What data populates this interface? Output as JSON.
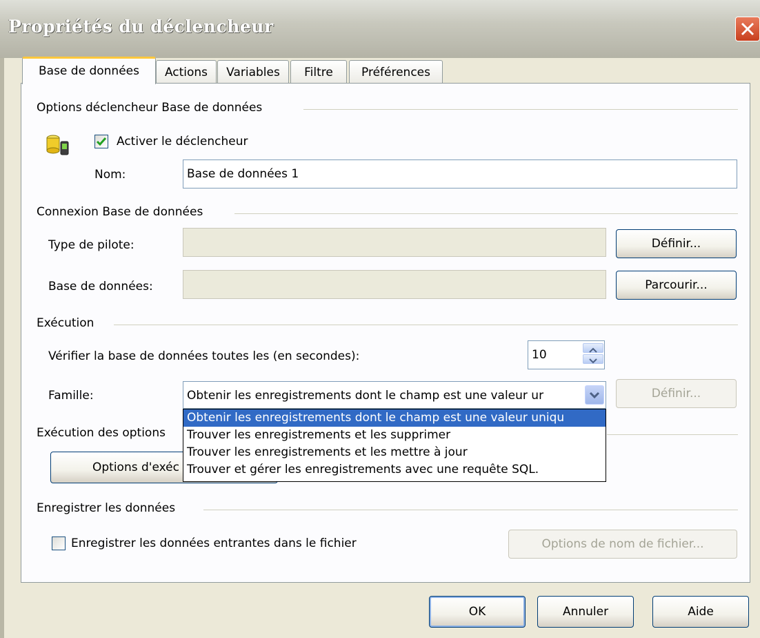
{
  "window": {
    "title": "Propriétés du déclencheur"
  },
  "tabs": [
    {
      "label": "Base de données",
      "active": true
    },
    {
      "label": "Actions",
      "active": false
    },
    {
      "label": "Variables",
      "active": false
    },
    {
      "label": "Filtre",
      "active": false
    },
    {
      "label": "Préférences",
      "active": false
    }
  ],
  "options_group": {
    "title": "Options déclencheur Base de données",
    "enable_checkbox": {
      "label": "Activer le déclencheur",
      "checked": true
    },
    "name_label": "Nom:",
    "name_value": "Base de données 1"
  },
  "connection_group": {
    "title": "Connexion Base de données",
    "driver_label": "Type de pilote:",
    "driver_value": "",
    "define_button": "Définir...",
    "database_label": "Base de données:",
    "database_value": "",
    "browse_button": "Parcourir..."
  },
  "execution_group": {
    "title": "Exécution",
    "interval_label": "Vérifier la base de données toutes les (en secondes):",
    "interval_value": "10",
    "family_label": "Famille:",
    "family_selected": "Obtenir les enregistrements dont le champ est une valeur ur",
    "family_define_button": "Définir...",
    "family_options": [
      "Obtenir les enregistrements dont le champ est une valeur uniqu",
      "Trouver les enregistrements et les supprimer",
      "Trouver les enregistrements et les mettre à jour",
      "Trouver et gérer les enregistrements avec une requête SQL."
    ]
  },
  "exec_options_group": {
    "title": "Exécution des options",
    "button": "Options d'exéc"
  },
  "save_group": {
    "title": "Enregistrer les données",
    "save_checkbox": {
      "label": "Enregistrer les données entrantes dans le fichier",
      "checked": false
    },
    "filename_button": "Options de nom de fichier..."
  },
  "footer": {
    "ok": "OK",
    "cancel": "Annuler",
    "help": "Aide"
  },
  "colors": {
    "dialog_bg": "#ece9d8",
    "panel_bg": "#fcfcfe",
    "active_tab_accent": "#ffc83c",
    "selection": "#316ac5",
    "close_button": "#c8401e"
  },
  "icons": [
    "close-icon",
    "database-icon",
    "checkmark-icon",
    "spin-up-icon",
    "spin-down-icon",
    "chevron-down-icon"
  ]
}
